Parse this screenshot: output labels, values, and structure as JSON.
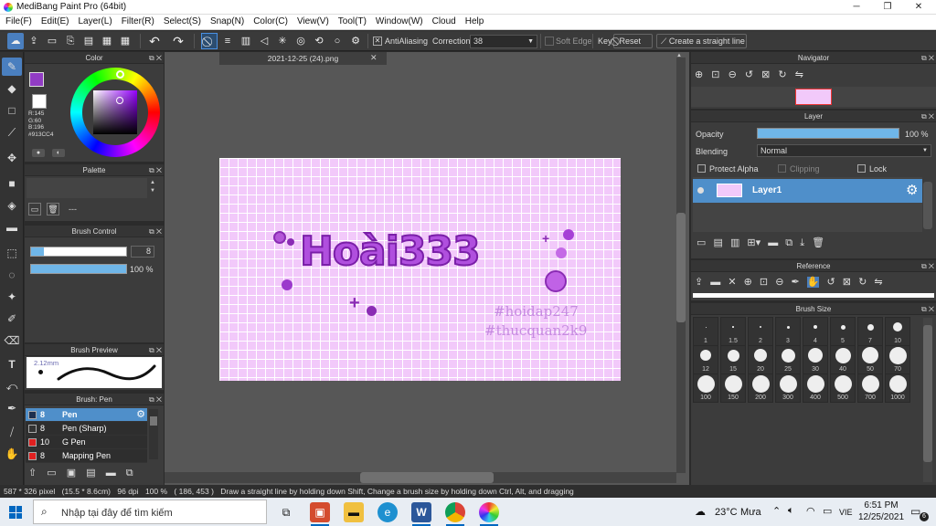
{
  "window": {
    "title": "MediBang Paint Pro (64bit)",
    "controls": [
      "─",
      "❐",
      "✕"
    ]
  },
  "menu": [
    "File(F)",
    "Edit(E)",
    "Layer(L)",
    "Filter(R)",
    "Select(S)",
    "Snap(N)",
    "Color(C)",
    "View(V)",
    "Tool(T)",
    "Window(W)",
    "Cloud",
    "Help"
  ],
  "toolbar": {
    "antialiasing": "AntiAliasing",
    "correction_label": "Correction",
    "correction_value": "38",
    "soft_edge": "Soft Edge",
    "key": "Key",
    "reset": "Reset",
    "straight_line": "Create a straight line"
  },
  "color_panel": {
    "title": "Color",
    "r": "R:145",
    "g": "G:60",
    "b": "B:196",
    "hex": "#913CC4",
    "main_color": "#913cc4"
  },
  "palette_panel": {
    "title": "Palette",
    "empty": "---"
  },
  "brush_control": {
    "title": "Brush Control",
    "size": "8",
    "opacity": "100 %",
    "opacity_value": 1.0
  },
  "brush_preview": {
    "title": "Brush Preview",
    "size_text": "2.12mm"
  },
  "brush_list": {
    "title": "Brush: Pen",
    "items": [
      {
        "size": "8",
        "name": "Pen",
        "color": "#1e2f4f",
        "selected": true
      },
      {
        "size": "8",
        "name": "Pen (Sharp)",
        "color": "#333333",
        "selected": false
      },
      {
        "size": "10",
        "name": "G Pen",
        "color": "#e02020",
        "selected": false
      },
      {
        "size": "8",
        "name": "Mapping Pen",
        "color": "#e02020",
        "selected": false
      }
    ]
  },
  "document": {
    "tab": "2021-12-25 (24).png",
    "art_text": "Hoài333",
    "tag1": "#hoidap247",
    "tag2": "#thucquan2k9"
  },
  "navigator": {
    "title": "Navigator"
  },
  "layer_panel": {
    "title": "Layer",
    "opacity_label": "Opacity",
    "opacity_value": "100 %",
    "blending_label": "Blending",
    "blending_value": "Normal",
    "protect_alpha": "Protect Alpha",
    "clipping": "Clipping",
    "lock": "Lock",
    "layer_name": "Layer1"
  },
  "reference": {
    "title": "Reference"
  },
  "brush_size": {
    "title": "Brush Size",
    "sizes": [
      "1",
      "1.5",
      "2",
      "3",
      "4",
      "5",
      "7",
      "10",
      "12",
      "15",
      "20",
      "25",
      "30",
      "40",
      "50",
      "70",
      "100",
      "150",
      "200",
      "300",
      "400",
      "500",
      "700",
      "1000"
    ]
  },
  "status": {
    "dimensions": "587 * 326 pixel",
    "physical": "(15.5 * 8.6cm)",
    "dpi": "96 dpi",
    "zoom": "100 %",
    "coords": "( 186, 453 )",
    "hint": "Draw a straight line by holding down Shift, Change a brush size by holding down Ctrl, Alt, and dragging"
  },
  "taskbar": {
    "search": "Nhập tại đây để tìm kiếm",
    "temp": "23°C",
    "weather": "Mưa",
    "lang": "VIE",
    "time": "6:51 PM",
    "date": "12/25/2021",
    "notif": "6"
  }
}
